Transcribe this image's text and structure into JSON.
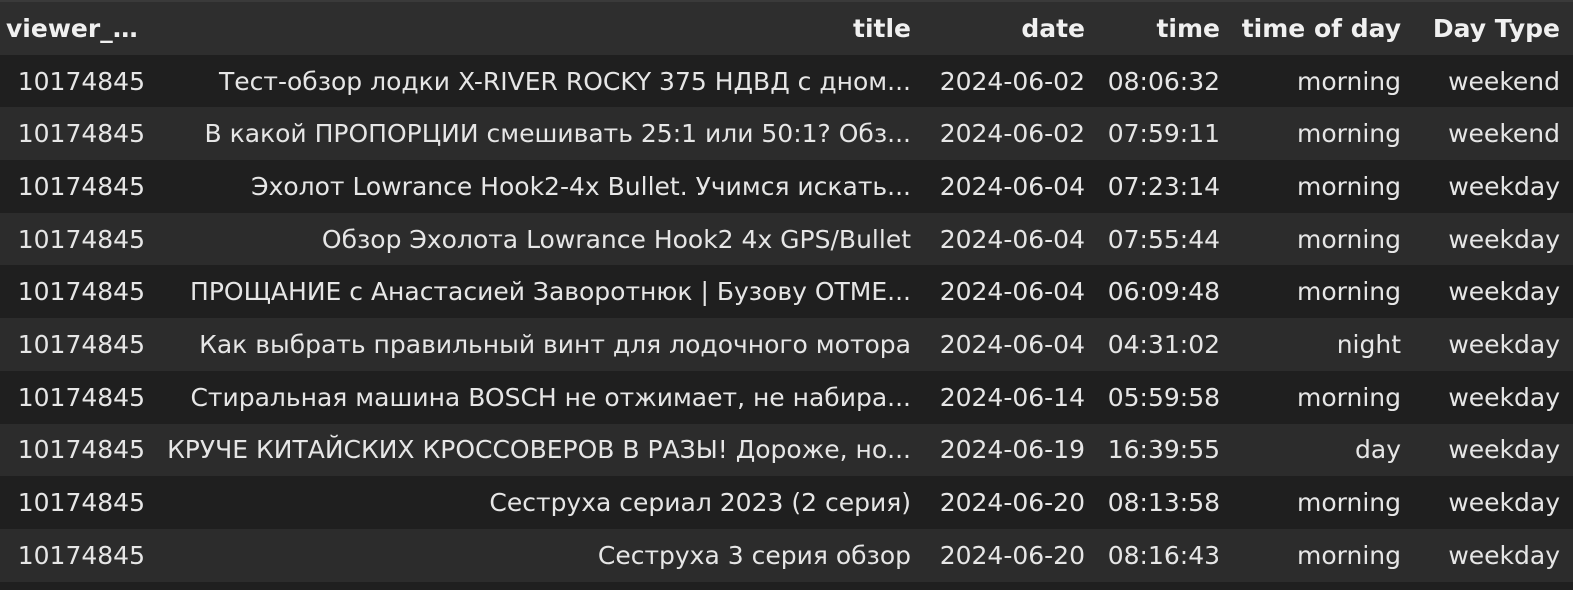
{
  "columns": {
    "viewer_uid": "viewer_uid",
    "title": "title",
    "date": "date",
    "time": "time",
    "time_of_day": "time of day",
    "day_type": "Day Type"
  },
  "rows": [
    {
      "viewer_uid": "10174845",
      "title": "Тест-обзор лодки X-RIVER ROCKY 375 НДВД с дном...",
      "date": "2024-06-02",
      "time": "08:06:32",
      "time_of_day": "morning",
      "day_type": "weekend"
    },
    {
      "viewer_uid": "10174845",
      "title": "В какой ПРОПОРЦИИ смешивать 25:1 или 50:1? Обз...",
      "date": "2024-06-02",
      "time": "07:59:11",
      "time_of_day": "morning",
      "day_type": "weekend"
    },
    {
      "viewer_uid": "10174845",
      "title": "Эхолот Lowrance Hook2-4x Bullet. Учимся искать...",
      "date": "2024-06-04",
      "time": "07:23:14",
      "time_of_day": "morning",
      "day_type": "weekday"
    },
    {
      "viewer_uid": "10174845",
      "title": "Обзор Эхолота Lowrance Hook2 4x GPS/Bullet",
      "date": "2024-06-04",
      "time": "07:55:44",
      "time_of_day": "morning",
      "day_type": "weekday"
    },
    {
      "viewer_uid": "10174845",
      "title": "ПРОЩАНИЕ с Анастасией Заворотнюк | Бузову ОТМЕ...",
      "date": "2024-06-04",
      "time": "06:09:48",
      "time_of_day": "morning",
      "day_type": "weekday"
    },
    {
      "viewer_uid": "10174845",
      "title": "Как выбрать правильный винт для лодочного мотора",
      "date": "2024-06-04",
      "time": "04:31:02",
      "time_of_day": "night",
      "day_type": "weekday"
    },
    {
      "viewer_uid": "10174845",
      "title": "Стиральная машина BOSCH не отжимает, не набира...",
      "date": "2024-06-14",
      "time": "05:59:58",
      "time_of_day": "morning",
      "day_type": "weekday"
    },
    {
      "viewer_uid": "10174845",
      "title": "КРУЧЕ КИТАЙСКИХ КРОССОВЕРОВ В РАЗЫ! Дороже, но...",
      "date": "2024-06-19",
      "time": "16:39:55",
      "time_of_day": "day",
      "day_type": "weekday"
    },
    {
      "viewer_uid": "10174845",
      "title": "Сеструха сериал 2023 (2 серия)",
      "date": "2024-06-20",
      "time": "08:13:58",
      "time_of_day": "morning",
      "day_type": "weekday"
    },
    {
      "viewer_uid": "10174845",
      "title": "Сеструха 3 серия обзор",
      "date": "2024-06-20",
      "time": "08:16:43",
      "time_of_day": "morning",
      "day_type": "weekday"
    }
  ],
  "colors": {
    "background": "#1f1f1f",
    "header_bg": "#2e2e2e",
    "row_alt_bg": "#2c2c2c",
    "text": "#e6e6e6"
  }
}
